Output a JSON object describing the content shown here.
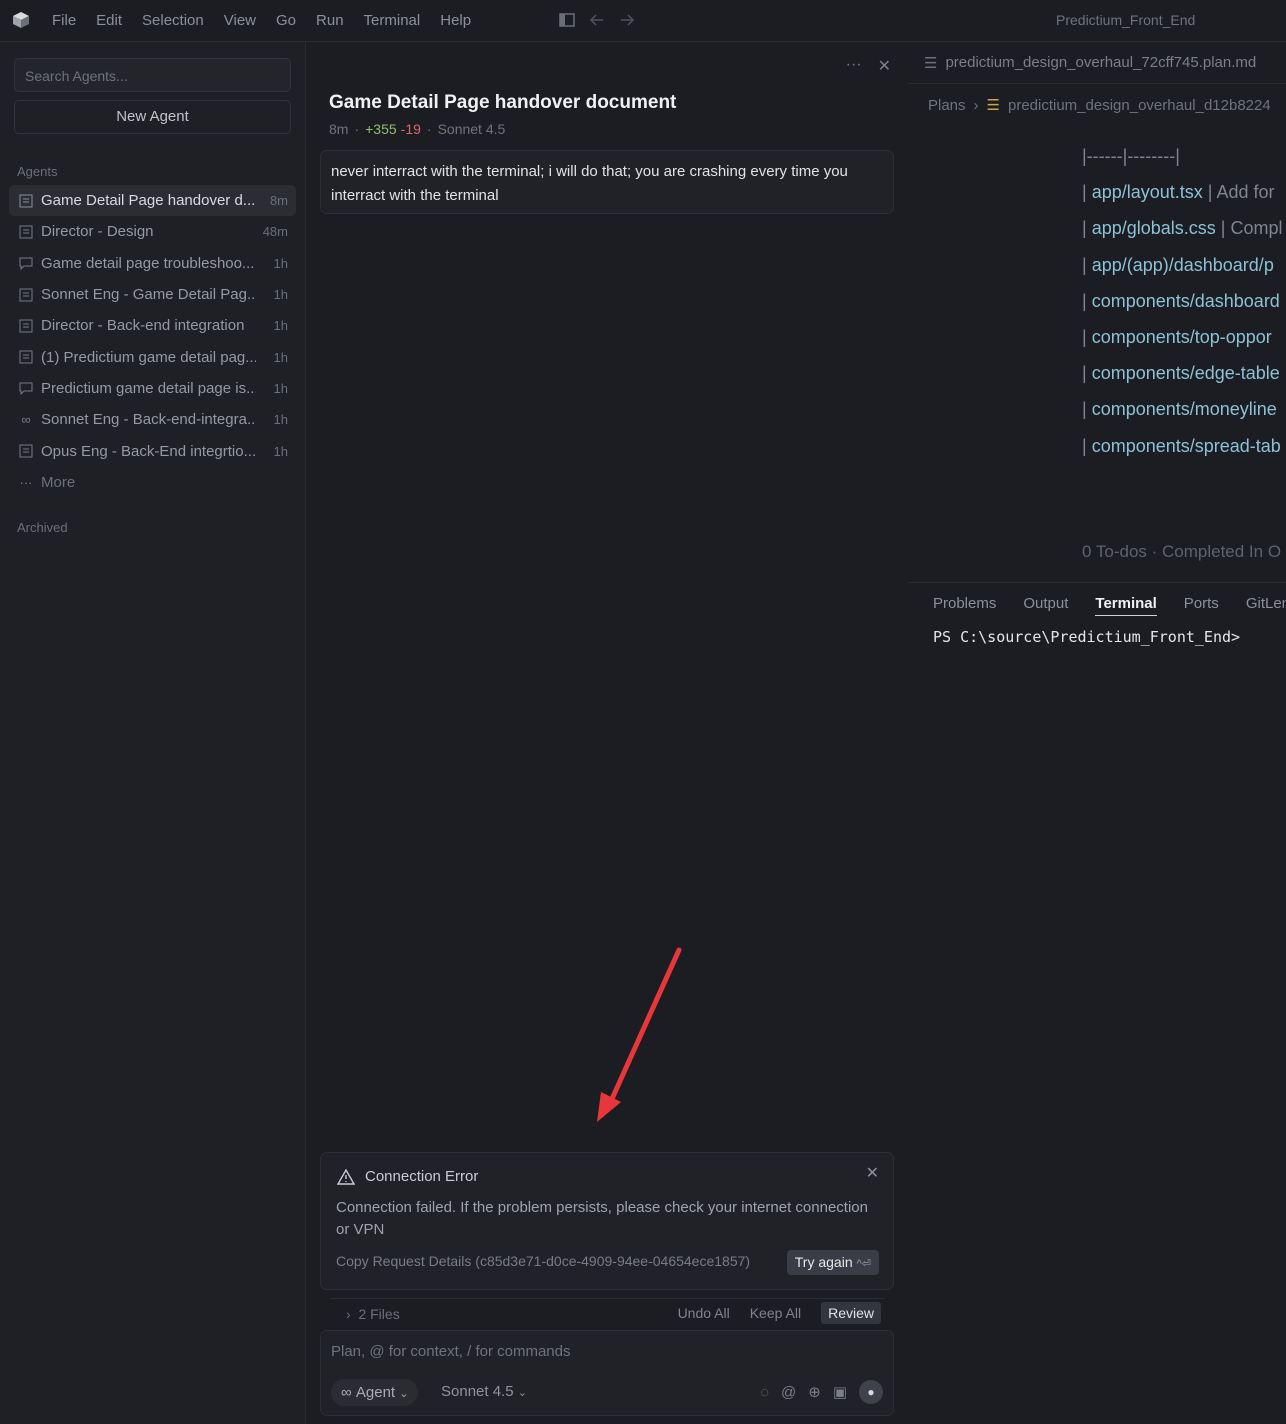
{
  "menu": {
    "items": [
      "File",
      "Edit",
      "Selection",
      "View",
      "Go",
      "Run",
      "Terminal",
      "Help"
    ],
    "window_title": "Predictium_Front_End"
  },
  "sidebar": {
    "search_placeholder": "Search Agents...",
    "new_agent_label": "New Agent",
    "agents_heading": "Agents",
    "archived_heading": "Archived",
    "agents": [
      {
        "label": "Game Detail Page handover d...",
        "time": "8m",
        "icon": "plan-doc-icon",
        "active": true
      },
      {
        "label": "Director - Design",
        "time": "48m",
        "icon": "plan-doc-icon"
      },
      {
        "label": "Game detail page troubleshoo...",
        "time": "1h",
        "icon": "chat-bubble-icon"
      },
      {
        "label": "Sonnet Eng - Game Detail Pag...",
        "time": "1h",
        "icon": "plan-doc-icon"
      },
      {
        "label": "Director - Back-end integration",
        "time": "1h",
        "icon": "plan-doc-icon"
      },
      {
        "label": "(1) Predictium game detail pag...",
        "time": "1h",
        "icon": "plan-doc-icon"
      },
      {
        "label": "Predictium game detail page is...",
        "time": "1h",
        "icon": "chat-bubble-icon"
      },
      {
        "label": "Sonnet Eng - Back-end-integra...",
        "time": "1h",
        "icon": "infinity-icon"
      },
      {
        "label": "Opus Eng - Back-End integrtio...",
        "time": "1h",
        "icon": "plan-doc-icon"
      }
    ],
    "more_label": "More"
  },
  "chat": {
    "title": "Game Detail Page handover document",
    "age": "8m",
    "dot": "·",
    "added": "+355",
    "removed": "-19",
    "model": "Sonnet 4.5",
    "message": "never interract with the terminal; i will do that;  you are crashing every time you interract with the terminal",
    "error": {
      "title": "Connection Error",
      "body": "Connection failed. If the problem persists, please check your internet connection or VPN",
      "copy_details": "Copy Request Details (c85d3e71-d0ce-4909-94ee-04654ece1857)",
      "try_again": "Try again",
      "try_again_kbd": "^⏎"
    },
    "files_summary": "2 Files",
    "undo_all": "Undo All",
    "keep_all": "Keep All",
    "review": "Review",
    "input_placeholder": "Plan, @ for context, / for commands",
    "mode": "Agent",
    "model_select": "Sonnet 4.5"
  },
  "editor": {
    "tab_title": "predictium_design_overhaul_72cff745.plan.md",
    "breadcrumb_root": "Plans",
    "breadcrumb_file": "predictium_design_overhaul_d12b8224",
    "table_divider": "|------|--------|",
    "rows": [
      {
        "path": "app/layout.tsx",
        "desc": "Add for"
      },
      {
        "path": "app/globals.css",
        "desc": "Compl"
      },
      {
        "path": "app/(app)/dashboard/p",
        "desc": ""
      },
      {
        "path": "components/dashboard",
        "desc": ""
      },
      {
        "path": "components/top-oppor",
        "desc": ""
      },
      {
        "path": "components/edge-table",
        "desc": ""
      },
      {
        "path": "components/moneyline",
        "desc": ""
      },
      {
        "path": "components/spread-tab",
        "desc": ""
      }
    ],
    "todos": "0 To-dos · Completed In O"
  },
  "panel": {
    "tabs": [
      "Problems",
      "Output",
      "Terminal",
      "Ports",
      "GitLen"
    ],
    "active_tab": "Terminal",
    "terminal_prompt": "PS C:\\source\\Predictium_Front_End>"
  },
  "colors": {
    "background": "#1b1d22",
    "added": "#8fbf6a",
    "removed": "#d46a6a",
    "arrow": "#e8373b",
    "link": "#8cc1d6"
  }
}
